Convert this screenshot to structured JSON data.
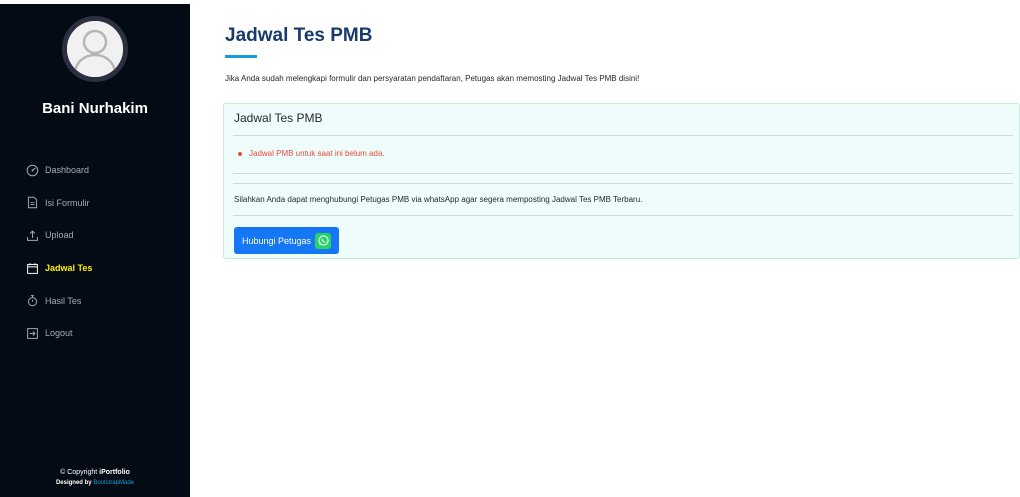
{
  "sidebar": {
    "user_name": "Bani Nurhakim",
    "nav": [
      {
        "label": "Dashboard",
        "icon": "dashboard-icon"
      },
      {
        "label": "Isi Formulir",
        "icon": "file-icon"
      },
      {
        "label": "Upload",
        "icon": "upload-icon"
      },
      {
        "label": "Jadwal Tes",
        "icon": "calendar-icon",
        "active": true
      },
      {
        "label": "Hasil Tes",
        "icon": "stopwatch-icon"
      },
      {
        "label": "Logout",
        "icon": "logout-icon"
      }
    ],
    "footer": {
      "copyright_prefix": "© Copyright ",
      "brand": "iPortfolio",
      "designed_prefix": "Designed by ",
      "designed_link": "BootstrapMade"
    }
  },
  "main": {
    "title": "Jadwal Tes PMB",
    "intro": "Jika Anda sudah melengkapi formulir dan persyaratan pendaftaran, Petugas akan memosting Jadwal Tes PMB disini!",
    "panel": {
      "title": "Jadwal Tes PMB",
      "notice": "Jadwal PMB untuk saat ini belum ada.",
      "hint": "Silahkan Anda dapat menghubungi Petugas PMB via whatsApp agar segera memposting Jadwal Tes PMB Terbaru.",
      "button_label": "Hubungi Petugas"
    }
  },
  "colors": {
    "sidebar_bg": "#040b14",
    "title": "#173b6c",
    "accent": "#149ddd",
    "active_nav": "#ffee00",
    "notice": "#e74c3c",
    "button": "#1577f4",
    "whatsapp": "#25d366"
  }
}
